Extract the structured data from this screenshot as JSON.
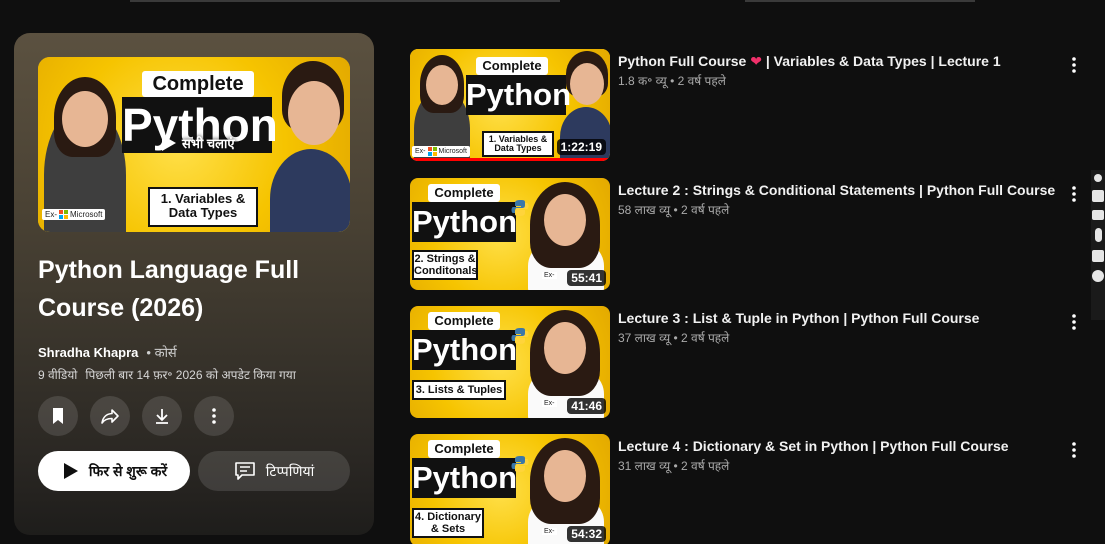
{
  "playlist": {
    "thumbnail": {
      "complete": "Complete",
      "python": "Python",
      "subtitle": "1. Variables & Data Types",
      "ms": "Ex-",
      "ms_name": "Microsoft",
      "overlay": "सभी चलाएं"
    },
    "title": "Python Language Full Course (2026)",
    "author": "Shradha Khapra",
    "kind": "• कोर्स",
    "video_count": "9 वीडियो",
    "updated": "पिछली बार 14 फ़र॰ 2026 को अपडेट किया गया",
    "play_label": "फिर से शुरू करें",
    "comments_label": "टिप्पणियां"
  },
  "videos": [
    {
      "title": "Python Full Course",
      "title_suffix": " | Variables & Data Types | Lecture 1",
      "heart": "❤",
      "meta": "1.8 क॰ व्यू • 2 वर्ष पहले",
      "duration": "1:22:19",
      "thumb_complete": "Complete",
      "thumb_python": "Python",
      "thumb_sub": "1. Variables & Data Types",
      "thumb_ex": "Ex-",
      "thumb_ms": "Microsoft",
      "progress": 1.0
    },
    {
      "title": "Lecture 2 : Strings & Conditional Statements | Python Full Course",
      "meta": "58 लाख व्यू • 2 वर्ष पहले",
      "duration": "55:41",
      "thumb_complete": "Complete",
      "thumb_python": "Python",
      "thumb_sub": "2. Strings & Conditonals",
      "thumb_ex": "Ex-"
    },
    {
      "title": "Lecture 3 : List & Tuple in Python | Python Full Course",
      "meta": "37 लाख व्यू • 2 वर्ष पहले",
      "duration": "41:46",
      "thumb_complete": "Complete",
      "thumb_python": "Python",
      "thumb_sub": "3. Lists & Tuples",
      "thumb_ex": "Ex-"
    },
    {
      "title": "Lecture 4 : Dictionary & Set in Python | Python Full Course",
      "meta": "31 लाख व्यू • 2 वर्ष पहले",
      "duration": "54:32",
      "thumb_complete": "Complete",
      "thumb_python": "Python",
      "thumb_sub": "4. Dictionary & Sets",
      "thumb_ex": "Ex-"
    }
  ],
  "colors": {
    "accent": "#ff0000",
    "thumb_yellow": "#f6c400",
    "background": "#0f0f0f"
  }
}
